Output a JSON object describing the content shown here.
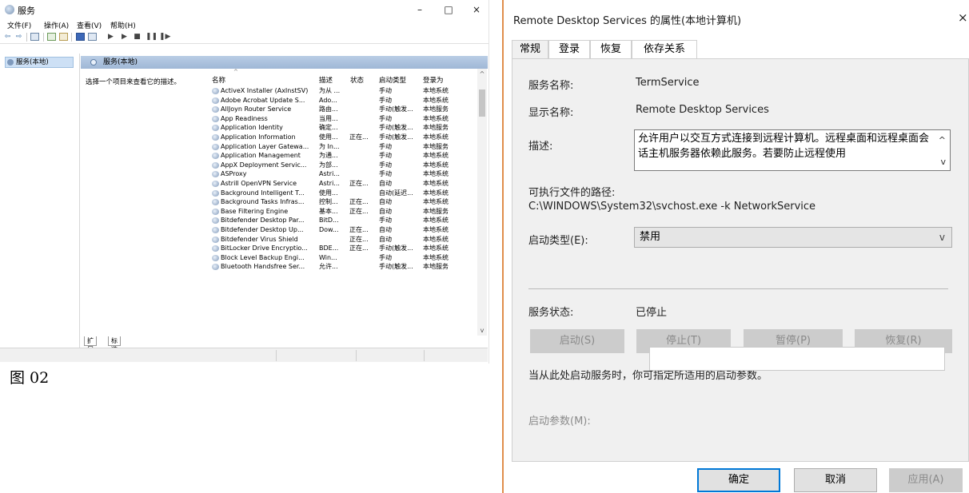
{
  "services_window": {
    "title": "服务",
    "window_controls": {
      "minimize": "–",
      "maximize": "□",
      "close": "×"
    },
    "menu": [
      "文件(F)",
      "操作(A)",
      "查看(V)",
      "帮助(H)"
    ],
    "toolbar_icons": [
      "back-arrow-icon",
      "forward-arrow-icon",
      "console-tree-icon",
      "refresh-icon",
      "export-icon",
      "help-icon",
      "view-icon",
      "play-icon",
      "play-next-icon",
      "stop-icon",
      "pause-icon",
      "restart-icon"
    ],
    "tree_item": "服务(本地)",
    "panel_header": "服务(本地)",
    "description_prompt": "选择一个项目来查看它的描述。",
    "columns": {
      "name": "名称",
      "description": "描述",
      "status": "状态",
      "startup_type": "启动类型",
      "logon_as": "登录为"
    },
    "rows": [
      {
        "name": "ActiveX Installer (AxInstSV)",
        "desc": "为从 ...",
        "status": "",
        "startup": "手动",
        "logon": "本地系统"
      },
      {
        "name": "Adobe Acrobat Update S...",
        "desc": "Ado...",
        "status": "",
        "startup": "手动",
        "logon": "本地系统"
      },
      {
        "name": "AllJoyn Router Service",
        "desc": "路由...",
        "status": "",
        "startup": "手动(触发...",
        "logon": "本地服务"
      },
      {
        "name": "App Readiness",
        "desc": "当用...",
        "status": "",
        "startup": "手动",
        "logon": "本地系统"
      },
      {
        "name": "Application Identity",
        "desc": "确定...",
        "status": "",
        "startup": "手动(触发...",
        "logon": "本地服务"
      },
      {
        "name": "Application Information",
        "desc": "使用...",
        "status": "正在...",
        "startup": "手动(触发...",
        "logon": "本地系统"
      },
      {
        "name": "Application Layer Gatewa...",
        "desc": "为 In...",
        "status": "",
        "startup": "手动",
        "logon": "本地服务"
      },
      {
        "name": "Application Management",
        "desc": "为通...",
        "status": "",
        "startup": "手动",
        "logon": "本地系统"
      },
      {
        "name": "AppX Deployment Servic...",
        "desc": "为部...",
        "status": "",
        "startup": "手动",
        "logon": "本地系统"
      },
      {
        "name": "ASProxy",
        "desc": "Astri...",
        "status": "",
        "startup": "手动",
        "logon": "本地系统"
      },
      {
        "name": "Astrill OpenVPN Service",
        "desc": "Astri...",
        "status": "正在...",
        "startup": "自动",
        "logon": "本地系统"
      },
      {
        "name": "Background Intelligent T...",
        "desc": "使用...",
        "status": "",
        "startup": "自动(延迟...",
        "logon": "本地系统"
      },
      {
        "name": "Background Tasks Infras...",
        "desc": "控制...",
        "status": "正在...",
        "startup": "自动",
        "logon": "本地系统"
      },
      {
        "name": "Base Filtering Engine",
        "desc": "基本...",
        "status": "正在...",
        "startup": "自动",
        "logon": "本地服务"
      },
      {
        "name": "Bitdefender Desktop Par...",
        "desc": "BitD...",
        "status": "",
        "startup": "手动",
        "logon": "本地系统"
      },
      {
        "name": "Bitdefender Desktop Up...",
        "desc": "Dow...",
        "status": "正在...",
        "startup": "自动",
        "logon": "本地系统"
      },
      {
        "name": "Bitdefender Virus Shield",
        "desc": "",
        "status": "正在...",
        "startup": "自动",
        "logon": "本地系统"
      },
      {
        "name": "BitLocker Drive Encryptio...",
        "desc": "BDE...",
        "status": "正在...",
        "startup": "手动(触发...",
        "logon": "本地系统"
      },
      {
        "name": "Block Level Backup Engi...",
        "desc": "Win...",
        "status": "",
        "startup": "手动",
        "logon": "本地系统"
      },
      {
        "name": "Bluetooth Handsfree Ser...",
        "desc": "允许...",
        "status": "",
        "startup": "手动(触发...",
        "logon": "本地服务"
      }
    ],
    "bottom_tabs": [
      "扩展",
      "标准"
    ]
  },
  "figure_caption": "图 02",
  "dialog": {
    "title": "Remote Desktop Services 的属性(本地计算机)",
    "close": "×",
    "tabs": [
      "常规",
      "登录",
      "恢复",
      "依存关系"
    ],
    "service_name_label": "服务名称:",
    "service_name": "TermService",
    "display_name_label": "显示名称:",
    "display_name": "Remote Desktop Services",
    "description_label": "描述:",
    "description": "允许用户以交互方式连接到远程计算机。远程桌面和远程桌面会话主机服务器依赖此服务。若要防止远程使用",
    "exe_path_label": "可执行文件的路径:",
    "exe_path": "C:\\WINDOWS\\System32\\svchost.exe -k NetworkService",
    "startup_type_label": "启动类型(E):",
    "startup_type_value": "禁用",
    "service_status_label": "服务状态:",
    "service_status": "已停止",
    "buttons": {
      "start": "启动(S)",
      "stop": "停止(T)",
      "pause": "暂停(P)",
      "resume": "恢复(R)"
    },
    "hint": "当从此处启动服务时，你可指定所适用的启动参数。",
    "start_params_label": "启动参数(M):",
    "start_params_value": "",
    "footer": {
      "ok": "确定",
      "cancel": "取消",
      "apply": "应用(A)"
    },
    "accent_color": "#0078d7"
  }
}
